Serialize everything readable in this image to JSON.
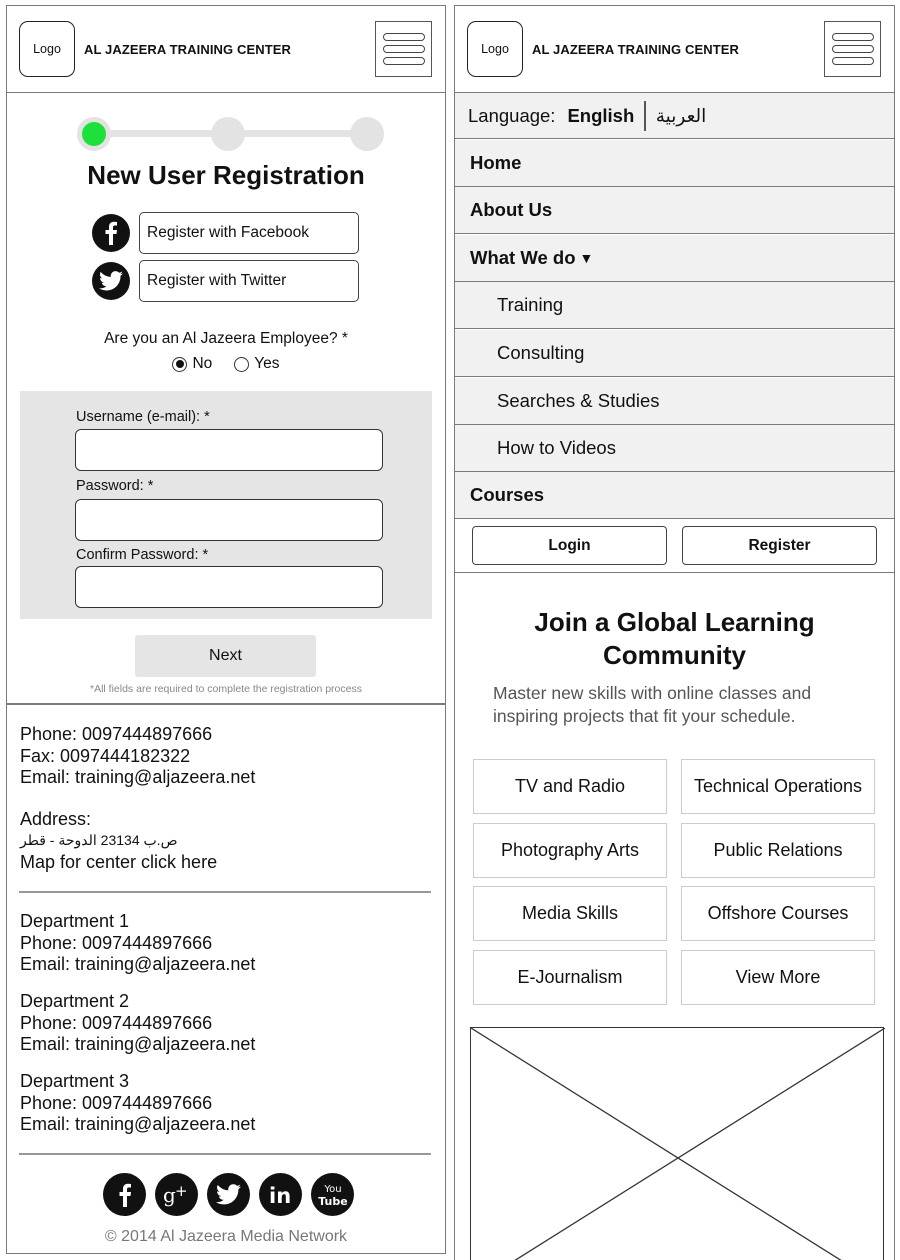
{
  "left": {
    "header": {
      "logo": "Logo",
      "title": "AL JAZEERA TRAINING CENTER"
    },
    "registration": {
      "title": "New User Registration",
      "progress_step": 1,
      "progress_total": 3,
      "facebook_btn": "Register with Facebook",
      "twitter_btn": "Register with Twitter",
      "employee_question": "Are you an Al Jazeera Employee? *",
      "options": [
        "No",
        "Yes"
      ],
      "selected_option": "No",
      "username_label": "Username (e-mail):  *",
      "password_label": "Password:  *",
      "confirm_label": "Confirm Password:  *",
      "next_btn": "Next",
      "note": "*All fields are required to complete the registration process"
    },
    "contact": {
      "phone": "Phone: 0097444897666",
      "fax": "Fax: 0097444182322",
      "email": "Email: training@aljazeera.net",
      "address_label": "Address:",
      "address_value": "ص.ب 23134 الدوحة - قطر",
      "map_link": "Map for center click here"
    },
    "departments": [
      {
        "name": "Department 1",
        "phone": "Phone: 0097444897666",
        "email": "Email: training@aljazeera.net"
      },
      {
        "name": "Department 2",
        "phone": "Phone: 0097444897666",
        "email": "Email: training@aljazeera.net"
      },
      {
        "name": "Department 3",
        "phone": "Phone: 0097444897666",
        "email": "Email: training@aljazeera.net"
      }
    ],
    "social_icons": [
      "facebook-icon",
      "google-plus-icon",
      "twitter-icon",
      "linkedin-icon",
      "youtube-icon"
    ],
    "copyright": "© 2014 Al Jazeera Media Network"
  },
  "right": {
    "header": {
      "logo": "Logo",
      "title": "AL JAZEERA TRAINING CENTER"
    },
    "language": {
      "label": "Language:",
      "current": "English",
      "alternate": "العربية"
    },
    "nav": {
      "home": "Home",
      "about": "About Us",
      "what_we_do": "What We do",
      "sub": [
        "Training",
        "Consulting",
        "Searches & Studies",
        "How to Videos"
      ],
      "courses": "Courses"
    },
    "auth": {
      "login": "Login",
      "register": "Register"
    },
    "hero": {
      "title_line1": "Join a Global Learning",
      "title_line2": "Community",
      "subtitle_line1": "Master new skills with online classes and",
      "subtitle_line2": "inspiring projects that fit your schedule."
    },
    "categories": [
      "TV and Radio",
      "Technical Operations",
      "Photography Arts",
      "Public Relations",
      "Media Skills",
      "Offshore Courses",
      "E-Journalism",
      "View More"
    ]
  },
  "colors": {
    "progress_active": "#1ee03a",
    "panel_gray": "#e5e5e5",
    "nav_bg": "#f1f1f1"
  }
}
